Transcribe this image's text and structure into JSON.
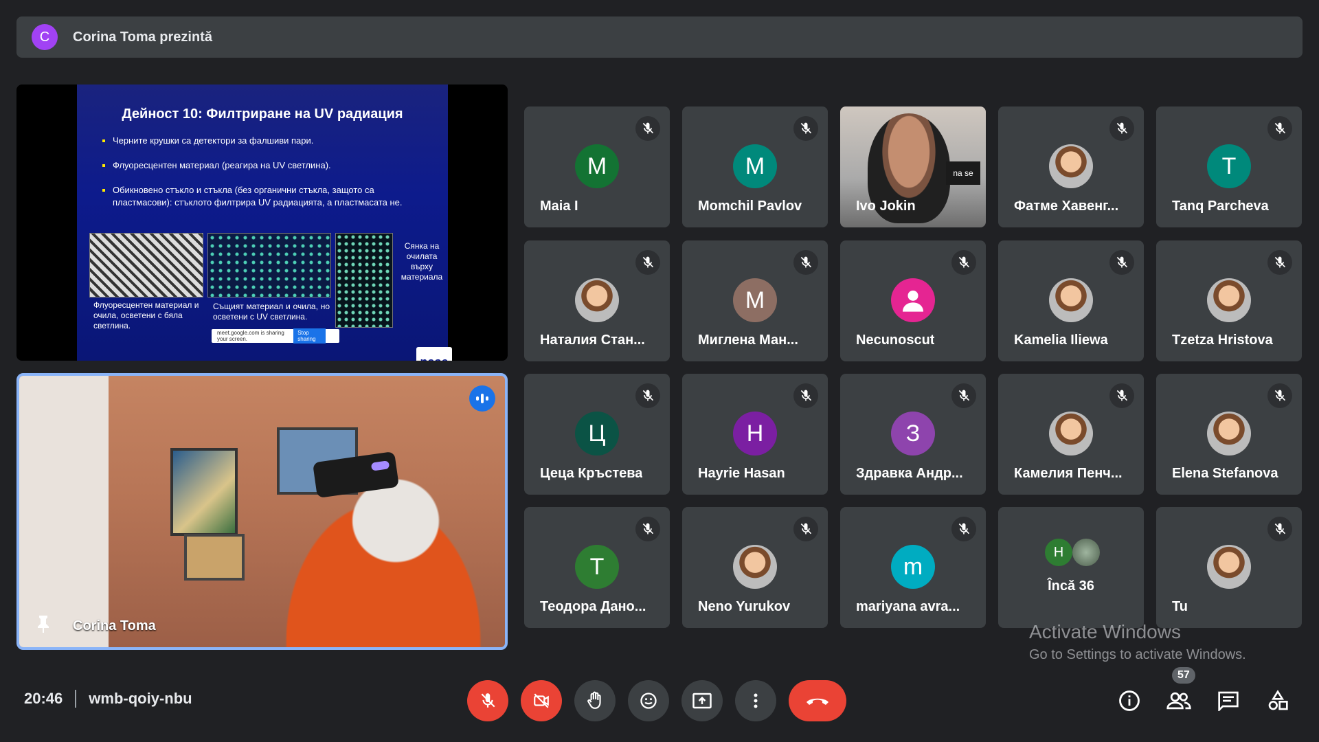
{
  "banner": {
    "avatar_letter": "C",
    "title": "Corina Toma prezintă"
  },
  "slide": {
    "title": "Дейност 10: Филтриране на UV радиация",
    "bullets": [
      "Черните крушки са детектори за фалшиви пари.",
      "Флуоресцентен материал (реагира на UV светлина).",
      "Обикновено стъкло и стъкла (без органични стъкла, защото са пластмасови): стъклото филтрира UV радиацията, а пластмасата не."
    ],
    "caption1": "Флуоресцентен материал и очила, осветени с бяла светлина.",
    "caption2": "Същият материал и очила, но осветени с UV светлина.",
    "caption3": "Сянка на очилата върху материала",
    "sharebar_text": "meet.google.com is sharing your screen.",
    "sharebar_button": "Stop sharing",
    "logo_text": "nase"
  },
  "speaker": {
    "name": "Corina Toma"
  },
  "participants": [
    {
      "name": "Maia I",
      "letter": "M",
      "color": "#137333"
    },
    {
      "name": "Momchil Pavlov",
      "letter": "M",
      "color": "#00897b"
    },
    {
      "name": "Ivo Jokin",
      "letter": "",
      "video": true
    },
    {
      "name": "Фатме Хавенг...",
      "letter": "",
      "photo": true
    },
    {
      "name": "Tanq Parcheva",
      "letter": "T",
      "color": "#00897b"
    },
    {
      "name": "Наталия Стан...",
      "letter": "",
      "photo": true
    },
    {
      "name": "Миглена Ман...",
      "letter": "M",
      "color": "#8d6e63"
    },
    {
      "name": "Necunoscut",
      "letter": "",
      "color": "#e52592",
      "anon": true
    },
    {
      "name": "Kamelia Ilіewa",
      "letter": "",
      "photo": true
    },
    {
      "name": "Tzetza Hristova",
      "letter": "",
      "photo": true
    },
    {
      "name": "Цеца Кръстева",
      "letter": "Ц",
      "color": "#0b5345"
    },
    {
      "name": "Hayrie Hasan",
      "letter": "H",
      "color": "#7b1fa2"
    },
    {
      "name": "Здравка Андр...",
      "letter": "З",
      "color": "#8e44ad"
    },
    {
      "name": "Камелия Пенч...",
      "letter": "",
      "photo": true
    },
    {
      "name": "Elena Stefanova",
      "letter": "",
      "photo": true
    },
    {
      "name": "Теодора Дано...",
      "letter": "T",
      "color": "#2e7d32"
    },
    {
      "name": "Neno Yurukov",
      "letter": "",
      "photo": true
    },
    {
      "name": "mariyana avra...",
      "letter": "m",
      "color": "#00acc1"
    },
    {
      "name": "",
      "more": true,
      "label": "Încă 36",
      "letter": "H"
    },
    {
      "name": "Tu",
      "letter": "",
      "photo": true
    }
  ],
  "watermark": {
    "line1": "Activate Windows",
    "line2": "Go to Settings to activate Windows."
  },
  "meeting": {
    "time": "20:46",
    "code": "wmb-qoiy-nbu"
  },
  "people_count": "57",
  "colors": {
    "end_call": "#ea4335",
    "accent": "#8ab4f8",
    "tile": "#3c4043",
    "background": "#202124"
  }
}
